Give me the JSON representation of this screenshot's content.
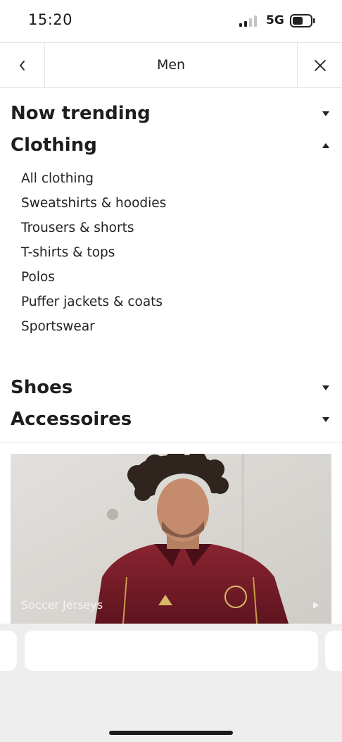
{
  "status": {
    "time": "15:20",
    "network": "5G"
  },
  "nav": {
    "title": "Men"
  },
  "sections": {
    "now_trending": "Now trending",
    "clothing": "Clothing",
    "shoes": "Shoes",
    "accessories": "Accessoires"
  },
  "clothing_items": [
    "All clothing",
    "Sweatshirts & hoodies",
    "Trousers & shorts",
    "T-shirts & tops",
    "Polos",
    "Puffer jackets & coats",
    "Sportswear"
  ],
  "promo": {
    "label": "Soccer Jerseys"
  },
  "icons": {
    "back": "chevron-left-icon",
    "close": "close-icon",
    "collapsed": "caret-down-icon",
    "expanded": "caret-up-icon",
    "promo_arrow": "play-arrow-icon"
  },
  "colors": {
    "jersey": "#7a1f2b",
    "text": "#1e1e1e",
    "divider": "#e4e4e4",
    "bottom_bg": "#eeeeee"
  }
}
